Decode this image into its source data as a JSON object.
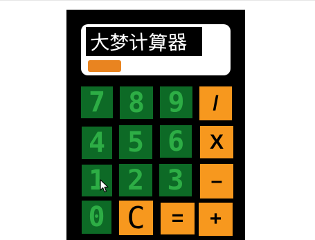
{
  "app": {
    "title": "大梦计算器"
  },
  "colors": {
    "body": "#000000",
    "display_bg": "#ffffff",
    "progress": "#e98420",
    "number_key_bg": "#0d6a26",
    "number_key_text": "#2dad45",
    "operator_key_bg": "#f7981e",
    "operator_key_text": "#000000"
  },
  "keys": {
    "k7": "7",
    "k8": "8",
    "k9": "9",
    "div": "/",
    "k4": "4",
    "k5": "5",
    "k6": "6",
    "mul": "X",
    "k1": "1",
    "k2": "2",
    "k3": "3",
    "sub": "–",
    "k0": "0",
    "clear": "C",
    "eq": "=",
    "add": "+"
  },
  "icons": {
    "pointer": "mouse-pointer-icon"
  }
}
